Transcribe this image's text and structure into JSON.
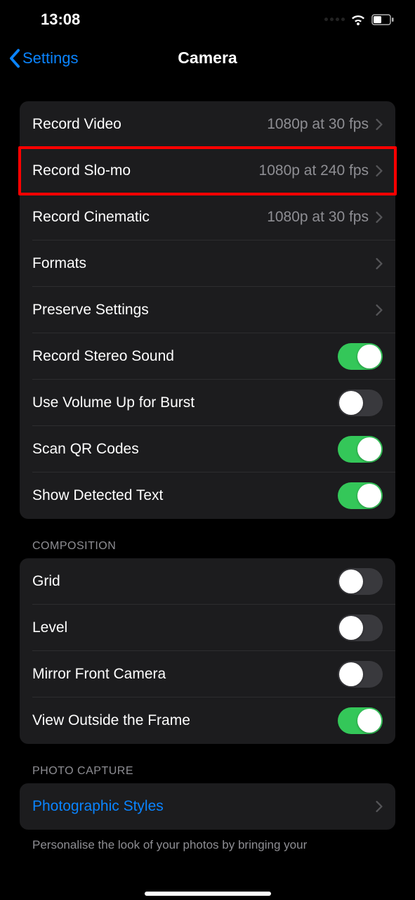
{
  "status": {
    "time": "13:08"
  },
  "nav": {
    "back": "Settings",
    "title": "Camera"
  },
  "group1": {
    "rows": [
      {
        "label": "Record Video",
        "value": "1080p at 30 fps",
        "chevron": true
      },
      {
        "label": "Record Slo-mo",
        "value": "1080p at 240 fps",
        "chevron": true,
        "highlighted": true
      },
      {
        "label": "Record Cinematic",
        "value": "1080p at 30 fps",
        "chevron": true
      },
      {
        "label": "Formats",
        "value": "",
        "chevron": true
      },
      {
        "label": "Preserve Settings",
        "value": "",
        "chevron": true
      },
      {
        "label": "Record Stereo Sound",
        "toggle": true,
        "on": true
      },
      {
        "label": "Use Volume Up for Burst",
        "toggle": true,
        "on": false
      },
      {
        "label": "Scan QR Codes",
        "toggle": true,
        "on": true
      },
      {
        "label": "Show Detected Text",
        "toggle": true,
        "on": true
      }
    ]
  },
  "group2": {
    "header": "COMPOSITION",
    "rows": [
      {
        "label": "Grid",
        "toggle": true,
        "on": false
      },
      {
        "label": "Level",
        "toggle": true,
        "on": false
      },
      {
        "label": "Mirror Front Camera",
        "toggle": true,
        "on": false
      },
      {
        "label": "View Outside the Frame",
        "toggle": true,
        "on": true
      }
    ]
  },
  "group3": {
    "header": "PHOTO CAPTURE",
    "rows": [
      {
        "label": "Photographic Styles",
        "link": true,
        "chevron": true
      }
    ],
    "footer": "Personalise the look of your photos by bringing your"
  }
}
